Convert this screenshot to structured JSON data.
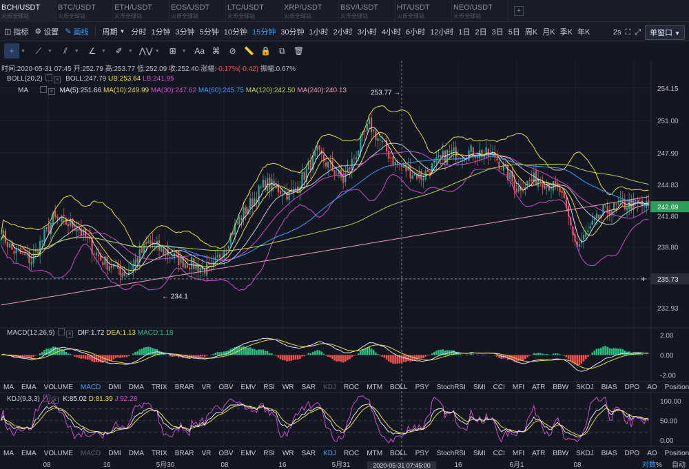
{
  "tabs": [
    {
      "symbol": "BCH/USDT",
      "sub": "火币全球站",
      "active": true
    },
    {
      "symbol": "BTC/USDT",
      "sub": "火币全球站",
      "active": false
    },
    {
      "symbol": "ETH/USDT",
      "sub": "火币全球站",
      "active": false
    },
    {
      "symbol": "EOS/USDT",
      "sub": "火币全球站",
      "active": false
    },
    {
      "symbol": "LTC/USDT",
      "sub": "火币全球站",
      "active": false
    },
    {
      "symbol": "XRP/USDT",
      "sub": "火币全球站",
      "active": false
    },
    {
      "symbol": "BSV/USDT",
      "sub": "火币全球站",
      "active": false
    },
    {
      "symbol": "HT/USDT",
      "sub": "火币全球站",
      "active": false
    },
    {
      "symbol": "NEO/USDT",
      "sub": "火币全球站",
      "active": false
    }
  ],
  "add_tab_label": "+",
  "toolbar": {
    "indicators_label": "指标",
    "settings_label": "设置",
    "draw_label": "画线",
    "period_label": "周期",
    "periods": [
      "分时",
      "1分钟",
      "3分钟",
      "5分钟",
      "10分钟",
      "15分钟",
      "30分钟",
      "1小时",
      "2小时",
      "3小时",
      "4小时",
      "6小时",
      "12小时",
      "1日",
      "2日",
      "3日",
      "5日",
      "周K",
      "月K",
      "季K",
      "年K"
    ],
    "active_period": "15分钟",
    "refresh": "2s",
    "window_mode": "单窗口"
  },
  "info_line": {
    "time_label": "时间:",
    "time": "2020-05-31 07:45",
    "open_label": "开:",
    "open": "252.79",
    "high_label": "高:",
    "high": "253.77",
    "low_label": "低:",
    "low": "252.09",
    "close_label": "收:",
    "close": "252.40",
    "change_label": "涨幅:",
    "change": "-0.17%(-0.42)",
    "amplitude_label": "振幅:",
    "amplitude": "0.67%"
  },
  "boll_legend": {
    "name": "BOLL(20,2)",
    "boll": "BOLL:247.79",
    "ub": "UB:253.64",
    "lb": "LB:241.95"
  },
  "ma_legend": {
    "name": "MA",
    "ma5": "MA(5):251.66",
    "ma10": "MA(10):249.99",
    "ma30": "MA(30):247.62",
    "ma60": "MA(60):245.75",
    "ma120": "MA(120):242.50",
    "ma240": "MA(240):240.13"
  },
  "macd_legend": {
    "name": "MACD(12,26,9)",
    "dif": "DIF:1.72",
    "dea": "DEA:1.13",
    "macd": "MACD:1.18"
  },
  "kdj_legend": {
    "name": "KDJ(9,3,3)",
    "k": "K:85.02",
    "d": "D:81.39",
    "j": "J:92.28"
  },
  "indicator_tabs": [
    "MA",
    "EMA",
    "VOLUME",
    "MACD",
    "DMI",
    "DMA",
    "TRIX",
    "BRAR",
    "VR",
    "OBV",
    "EMV",
    "RSI",
    "WR",
    "SAR",
    "KDJ",
    "ROC",
    "MTM",
    "BOLL",
    "PSY",
    "StochRSI",
    "SMI",
    "CCI",
    "MFI",
    "ATR",
    "BBW",
    "SKDJ",
    "BIAS",
    "DPO",
    "AO",
    "Position"
  ],
  "x_axis_labels": [
    "08",
    "16",
    "5月30",
    "08",
    "16",
    "5月31",
    "08",
    "16",
    "6月1",
    "08"
  ],
  "crosshair_time": "2020-05-31 07:45:00",
  "axis_footer": {
    "mode": "对数",
    "percent": "%",
    "auto": "自动"
  },
  "colors": {
    "up": "#26a69a",
    "down": "#ef5350",
    "bg": "#131722",
    "accent": "#3b9dff",
    "price_badge": "#2e9e5b"
  },
  "chart_data": [
    {
      "type": "candlestick",
      "title": "BCH/USDT 15分钟",
      "y_ticks": [
        254.15,
        251.0,
        247.9,
        244.83,
        241.8,
        238.8,
        235.73,
        232.93
      ],
      "ylim": [
        231.2,
        256.8
      ],
      "last_price": 242.69,
      "crosshair_price": 235.73,
      "annotations": [
        {
          "label": "253.77",
          "price": 253.77
        },
        {
          "label": "234.1",
          "price": 234.1
        }
      ],
      "series_legend": [
        "BOLL",
        "UB",
        "LB",
        "MA(5)",
        "MA(10)",
        "MA(30)",
        "MA(60)",
        "MA(120)",
        "MA(240)"
      ],
      "anchors": [
        [
          0,
          240.2
        ],
        [
          5,
          238.5
        ],
        [
          14,
          237.5
        ],
        [
          24,
          241.5
        ],
        [
          35,
          240.8
        ],
        [
          46,
          237.6
        ],
        [
          58,
          236.2
        ],
        [
          68,
          239.2
        ],
        [
          82,
          237.6
        ],
        [
          97,
          236.5
        ],
        [
          110,
          241.5
        ],
        [
          122,
          245.0
        ],
        [
          134,
          243.8
        ],
        [
          146,
          247.8
        ],
        [
          158,
          245.2
        ],
        [
          170,
          250.6
        ],
        [
          182,
          246.8
        ],
        [
          194,
          245.6
        ],
        [
          206,
          247.8
        ],
        [
          218,
          248.0
        ],
        [
          228,
          247.6
        ],
        [
          238,
          244.5
        ],
        [
          248,
          245.5
        ],
        [
          258,
          244.2
        ],
        [
          266,
          238.8
        ],
        [
          278,
          242.2
        ],
        [
          290,
          243.0
        ],
        [
          299,
          242.7
        ]
      ],
      "candle_count": 300
    },
    {
      "type": "bar",
      "title": "MACD(12,26,9)",
      "y_ticks": [
        2.0,
        0.0,
        -2.0
      ],
      "ylim": [
        -2.6,
        2.6
      ],
      "series": [
        "DIF",
        "DEA",
        "MACD"
      ]
    },
    {
      "type": "line",
      "title": "KDJ(9,3,3)",
      "y_ticks": [
        100.0,
        50.0,
        0.0
      ],
      "ylim": [
        -12,
        118
      ],
      "series": [
        "K",
        "D",
        "J"
      ]
    }
  ]
}
